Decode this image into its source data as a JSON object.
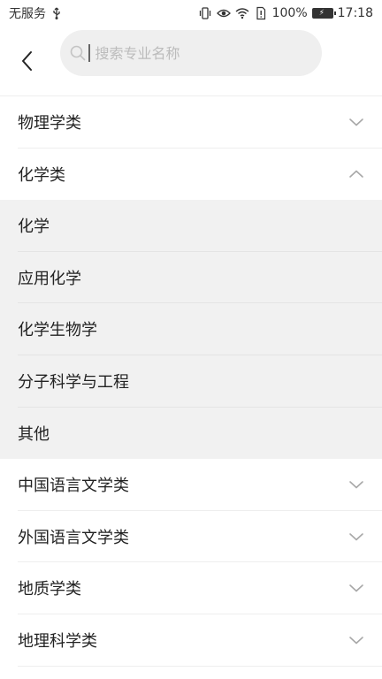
{
  "status_bar": {
    "carrier": "无服务",
    "battery": "100%",
    "time": "17:18"
  },
  "search": {
    "placeholder": "搜索专业名称"
  },
  "categories": [
    {
      "label": "物理学类",
      "expanded": false
    },
    {
      "label": "化学类",
      "expanded": true,
      "children": [
        "化学",
        "应用化学",
        "化学生物学",
        "分子科学与工程",
        "其他"
      ]
    },
    {
      "label": "中国语言文学类",
      "expanded": false
    },
    {
      "label": "外国语言文学类",
      "expanded": false
    },
    {
      "label": "地质学类",
      "expanded": false
    },
    {
      "label": "地理科学类",
      "expanded": false
    }
  ]
}
